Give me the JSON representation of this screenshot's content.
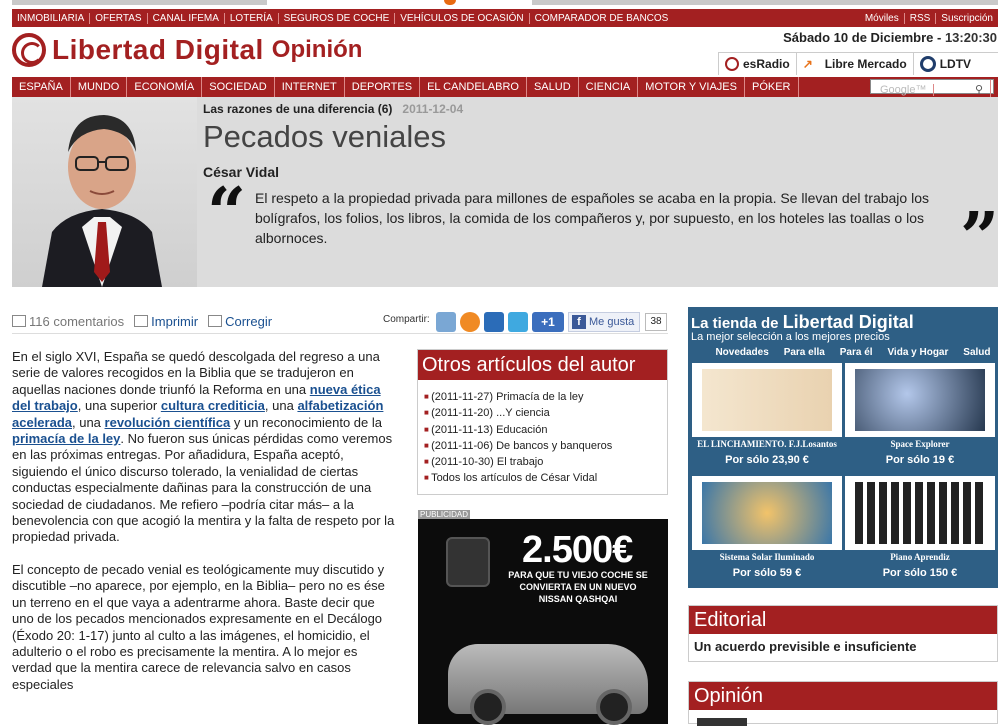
{
  "topbar": {
    "left": [
      "INMOBILIARIA",
      "OFERTAS",
      "CANAL IFEMA",
      "LOTERÍA",
      "SEGUROS DE COCHE",
      "VEHÍCULOS DE OCASIÓN",
      "COMPARADOR DE BANCOS"
    ],
    "right": [
      "Móviles",
      "RSS",
      "Suscripción"
    ]
  },
  "header": {
    "site": "Libertad Digital",
    "section": "Opinión",
    "date": "Sábado 10 de Diciembre",
    "time": "13:20:30"
  },
  "radios": [
    "esRadio",
    "Libre Mercado",
    "LDTV"
  ],
  "nav": {
    "items": [
      "ESPAÑA",
      "MUNDO",
      "ECONOMÍA",
      "SOCIEDAD",
      "INTERNET",
      "DEPORTES",
      "EL CANDELABRO",
      "SALUD",
      "CIENCIA",
      "MOTOR Y VIAJES",
      "PÓKER"
    ],
    "search_placeholder": "Google™"
  },
  "article": {
    "series": "Las razones de una diferencia (6)",
    "date": "2011-12-04",
    "title": "Pecados veniales",
    "author": "César Vidal",
    "lead": "El respeto a la propiedad privada para millones de españoles se acaba en la propia. Se llevan del trabajo los bolígrafos, los folios, los libros, la comida de los compañeros y, por supuesto, en los hoteles las toallas o los albornoces.",
    "comments": "116 comentarios",
    "print": "Imprimir",
    "correct": "Corregir",
    "share": "Compartir:",
    "plus1": "+1",
    "like": "Me gusta",
    "like_count": "38",
    "p1a": "En el siglo XVI, España se quedó descolgada del regreso a una serie de valores recogidos en la Biblia que se tradujeron en aquellas naciones donde triunfó la Reforma en una ",
    "l1": "nueva ética del trabajo",
    "p1b": ", una superior ",
    "l2": "cultura crediticia",
    "p1c": ", una ",
    "l3": "alfabetización acelerada",
    "p1d": ", una ",
    "l4": "revolución científica",
    "p1e": " y un reconocimiento de la ",
    "l5": "primacía de la ley",
    "p1f": ". No fueron sus únicas pérdidas como veremos en las próximas entregas. Por añadidura, España aceptó, siguiendo el único discurso tolerado, la venialidad de ciertas conductas especialmente dañinas para la construcción de una sociedad de ciudadanos. Me refiero –podría citar más– a la benevolencia con que acogió la mentira y la falta de respeto por la propiedad privada.",
    "p2": "El concepto de pecado venial es teológicamente muy discutido y discutible –no aparece, por ejemplo, en la Biblia– pero no es ése un terreno en el que vaya a adentrarme ahora. Baste decir que uno de los pecados mencionados expresamente en el Decálogo (Éxodo 20: 1-17) junto al culto a las imágenes, el homicidio, el adulterio o el robo es precisamente la mentira. A lo mejor es verdad que la mentira carece de relevancia salvo en casos especiales"
  },
  "others": {
    "heading": "Otros artículos del autor",
    "items": [
      "(2011-11-27) Primacía de la ley",
      "(2011-11-20) ...Y ciencia",
      "(2011-11-13) Educación",
      "(2011-11-06) De bancos y banqueros",
      "(2011-10-30) El trabajo",
      "Todos los artículos de César Vidal"
    ]
  },
  "ad": {
    "tag": "PUBLICIDAD",
    "price": "2.500€",
    "text": "PARA QUE TU VIEJO COCHE SE CONVIERTA EN UN NUEVO NISSAN QASHQAI"
  },
  "tienda": {
    "title_a": "La tienda de ",
    "title_b": "Libertad Digital",
    "subtitle": "La mejor selección a los mejores precios",
    "tabs": [
      "Novedades",
      "Para ella",
      "Para él",
      "Vida y Hogar",
      "Salud"
    ],
    "products": [
      {
        "name": "EL LINCHAMIENTO. F.J.Losantos",
        "price": "Por sólo 23,90 €"
      },
      {
        "name": "Space Explorer",
        "price": "Por sólo 19 €"
      },
      {
        "name": "Sistema Solar Iluminado",
        "price": "Por sólo 59 €"
      },
      {
        "name": "Piano Aprendiz",
        "price": "Por sólo 150 €"
      }
    ]
  },
  "editorial": {
    "heading": "Editorial",
    "text": "Un acuerdo previsible e insuficiente"
  },
  "opinion": {
    "heading": "Opinión"
  }
}
